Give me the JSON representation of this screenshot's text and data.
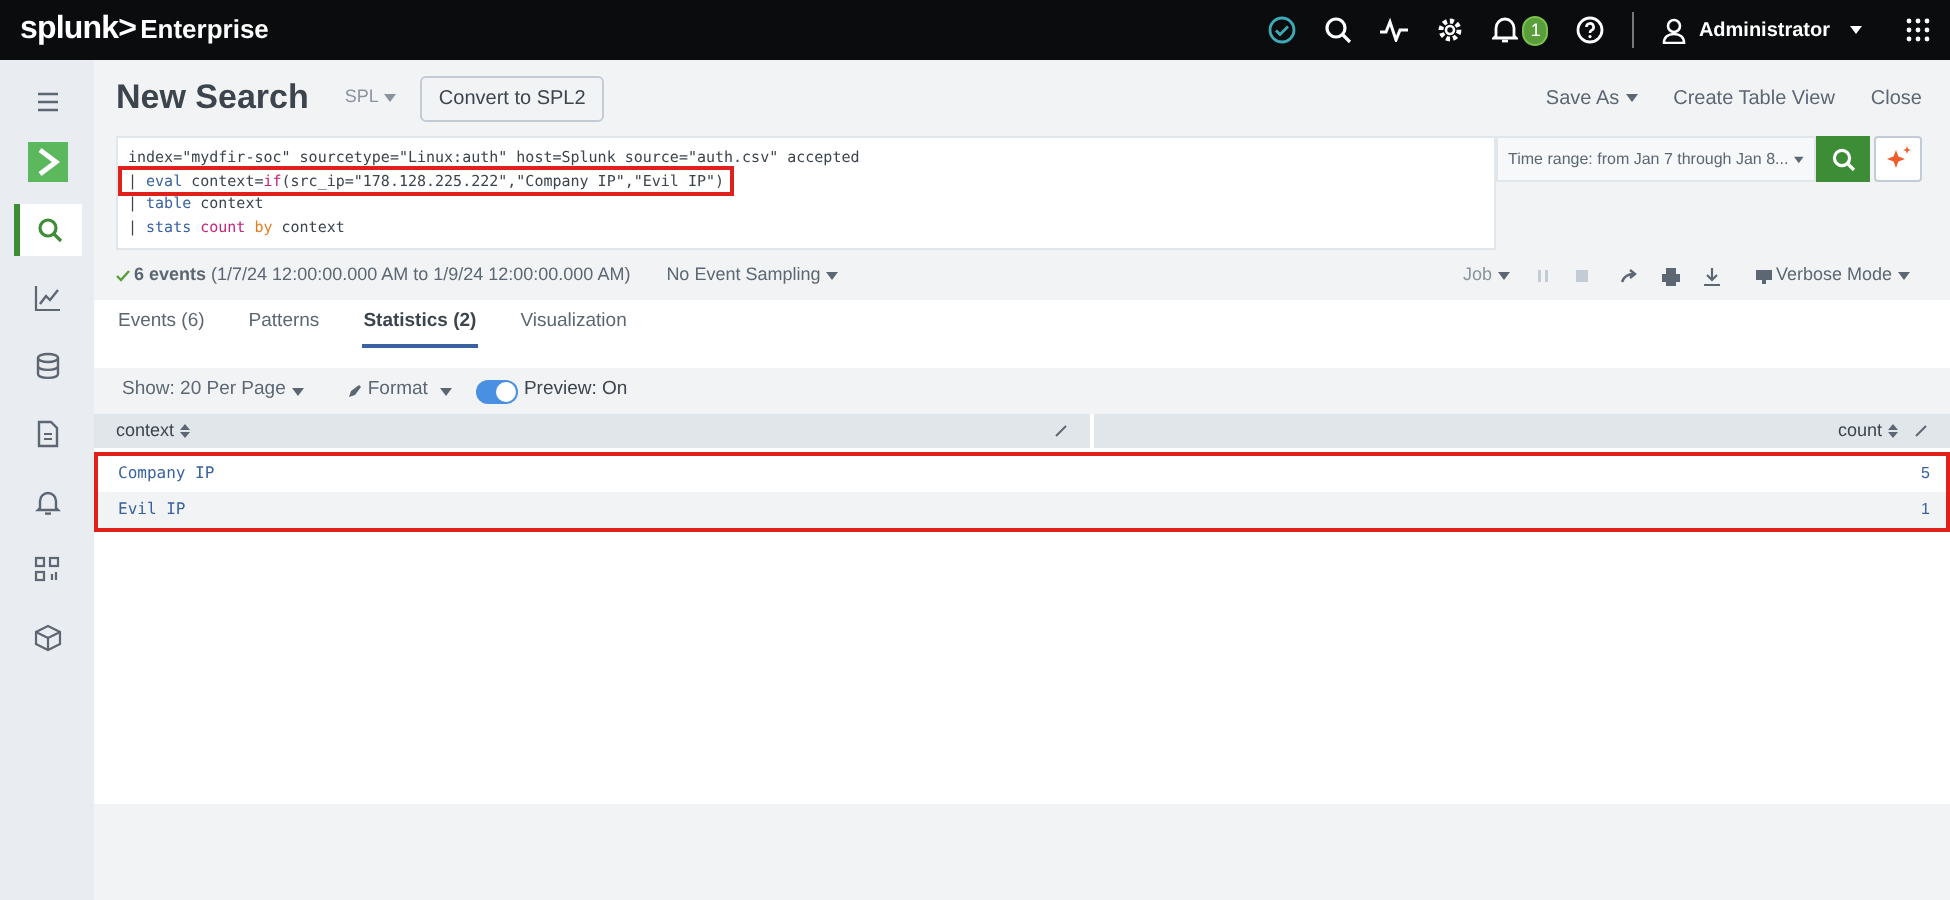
{
  "header": {
    "brand": "splunk>",
    "product": "Enterprise",
    "notification_count": "1",
    "user": "Administrator"
  },
  "sidebar": {
    "items": [
      {
        "kind": "menu",
        "selected": false
      },
      {
        "kind": "app",
        "selected": false
      },
      {
        "kind": "search",
        "selected": true
      },
      {
        "kind": "chart",
        "selected": false
      },
      {
        "kind": "database",
        "selected": false
      },
      {
        "kind": "document",
        "selected": false
      },
      {
        "kind": "bell",
        "selected": false
      },
      {
        "kind": "apps",
        "selected": false
      },
      {
        "kind": "box",
        "selected": false
      }
    ]
  },
  "title": "New Search",
  "language_menu": "SPL",
  "convert_button": "Convert to SPL2",
  "actions": [
    "Save As",
    "Create Table View",
    "Close"
  ],
  "query": {
    "lines": [
      {
        "highlighted": false,
        "tokens": [
          {
            "kind": "plain",
            "text": "index=\"mydfir-soc\" sourcetype=\"Linux:auth\" host=Splunk source=\"auth.csv\" accepted"
          }
        ]
      },
      {
        "highlighted": true,
        "tokens": [
          {
            "kind": "pipe",
            "text": "| "
          },
          {
            "kind": "command",
            "text": "eval"
          },
          {
            "kind": "plain",
            "text": " context="
          },
          {
            "kind": "function",
            "text": "if"
          },
          {
            "kind": "plain",
            "text": "(src_ip=\"178.128.225.222\",\"Company IP\",\"Evil IP\")"
          }
        ]
      },
      {
        "highlighted": false,
        "tokens": [
          {
            "kind": "pipe",
            "text": "| "
          },
          {
            "kind": "command",
            "text": "table"
          },
          {
            "kind": "plain",
            "text": " context"
          }
        ]
      },
      {
        "highlighted": false,
        "tokens": [
          {
            "kind": "pipe",
            "text": "| "
          },
          {
            "kind": "command",
            "text": "stats"
          },
          {
            "kind": "function",
            "text": " count"
          },
          {
            "kind": "keyword",
            "text": " by"
          },
          {
            "kind": "plain",
            "text": " context"
          }
        ]
      }
    ]
  },
  "time_range": "Time range: from Jan 7 through Jan 8...",
  "status": {
    "events": "6 events",
    "range": "(1/7/24 12:00:00.000 AM to 1/9/24 12:00:00.000 AM)",
    "sampling": "No Event Sampling"
  },
  "job_menu": "Job",
  "mode_menu": "Verbose Mode",
  "tabs": [
    {
      "label": "Events (6)",
      "selected": false
    },
    {
      "label": "Patterns",
      "selected": false
    },
    {
      "label": "Statistics (2)",
      "selected": true
    },
    {
      "label": "Visualization",
      "selected": false
    }
  ],
  "table_options": {
    "page_size": "Show: 20 Per Page",
    "format": "Format",
    "preview": {
      "label": "Preview: On",
      "on": true
    }
  },
  "table": {
    "highlighted": true,
    "columns": [
      "context",
      "count"
    ],
    "rows": [
      [
        "Company IP",
        "5"
      ],
      [
        "Evil IP",
        "1"
      ]
    ]
  }
}
